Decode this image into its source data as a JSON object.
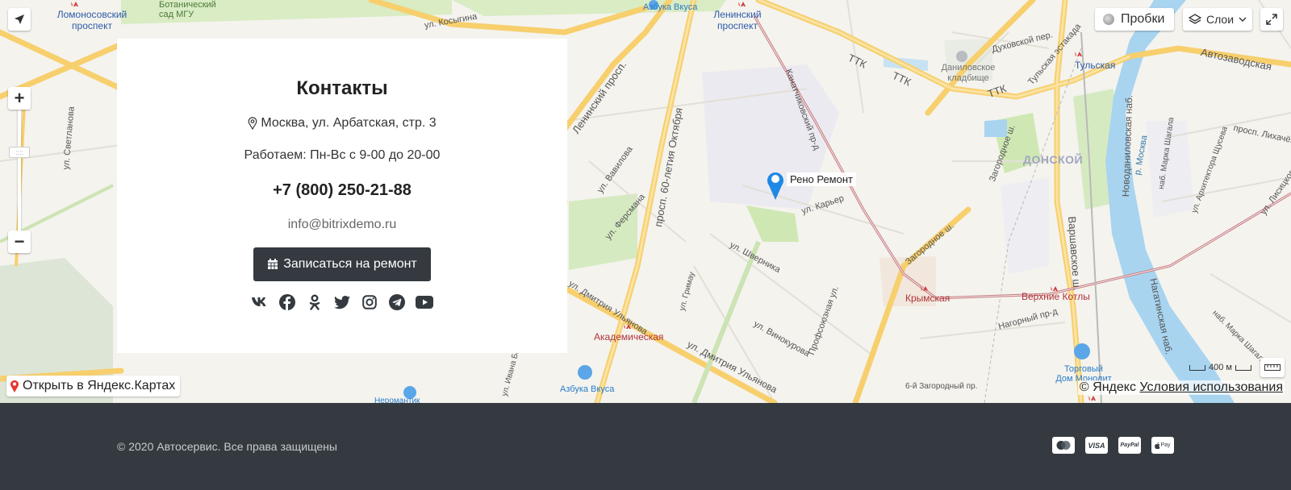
{
  "map": {
    "labels": {
      "lomonosovsky": "Ломоносовский проспект",
      "botanical": "Ботанический сад МГУ",
      "kosygina": "ул. Косыгина",
      "azbuka_top": "Азбука Вкуса",
      "leninsky_metro": "Ленинский проспект",
      "ttk1": "ТТК",
      "ttk2": "ТТК",
      "ttk3": "ТТК",
      "danilovskoe": "Даниловское кладбище",
      "dukhovsky": "Духовской пер.",
      "tulskaya_estakada": "Тульская эстакада",
      "tulskaya_metro": "Тульская",
      "avtozavodskaya": "Автозаводская",
      "leninsky_prosp": "Ленинский просп.",
      "kanatchikovsky": "Канатчиковский пр-д",
      "svetlanova": "ул. Светланова",
      "vavilova": "ул. Вавилова",
      "60_let": "просп. 60-летия Октября",
      "fersmana": "ул. Ферсмана",
      "karier": "ул. Карьер",
      "zagorodnoe1": "Загородное ш.",
      "zagorodnoe2": "Загородное ш.",
      "donskoy": "ДОНСКОЙ",
      "novodanilovskaya": "Новоданиловская наб.",
      "river": "р. Москва",
      "marka_shagala": "наб. Марка Шагала",
      "arkhitektora": "ул. Архитектора Щусева",
      "likhacheva": "просп. Лихачёва",
      "lisitskogo": "ул. Лисицкого",
      "shvernika": "ул. Шверника",
      "grimau": "ул. Гримау",
      "varshavskoe": "Варшавское ш.",
      "krymskaya": "Крымская",
      "verkhnie_kotly": "Верхние Котлы",
      "nagatinskaya": "Нагатинская наб.",
      "marka_shagala2": "наб. Марка Шагала",
      "ulyanova": "ул. Дмитрия Ульянова",
      "ulyanova2": "ул. Дмитрия Ульянова",
      "akademicheskaya": "Академическая",
      "vinokurova": "ул. Винокурова",
      "pushkinskaya": "Профсоюзная ул.",
      "nagorny": "Нагорный пр-д",
      "torgovy": "Торговый Дом Монолит",
      "zagorodny6": "6-й Загородный пр.",
      "azbuka_bottom": "Азбука Вкуса",
      "ivana_babushkina": "ул. Ивана Бабушкина",
      "neromantik": "Неромантик"
    },
    "marker_label": "Рено Ремонт",
    "controls": {
      "traffic": "Пробки",
      "layers": "Слои",
      "open_in_yandex": "Открыть в Яндекс.Картах",
      "scale": "400 м",
      "copyright": "© Яндекс",
      "terms": "Условия использования"
    }
  },
  "contacts": {
    "title": "Контакты",
    "address": "Москва, ул. Арбатская, стр. 3",
    "hours": "Работаем: Пн-Вс с 9-00 до 20-00",
    "phone": "+7 (800) 250-21-88",
    "email": "info@bitrixdemo.ru",
    "button": "Записаться на ремонт",
    "socials": [
      "vk-icon",
      "facebook-icon",
      "odnoklassniki-icon",
      "twitter-icon",
      "instagram-icon",
      "telegram-icon",
      "youtube-icon"
    ]
  },
  "footer": {
    "copyright": "© 2020 Автосервис. Все права защищены",
    "payments": [
      "mastercard-icon",
      "visa-icon",
      "paypal-icon",
      "applepay-icon"
    ],
    "visa": "VISA",
    "paypal": "PayPal",
    "applepay": "Pay"
  },
  "colors": {
    "accent": "#343a40",
    "road_major": "#f7cf6d",
    "river": "#a8d4f0",
    "park": "#cfe8b3",
    "metro": "#d13b3b",
    "marker": "#1e88e5"
  }
}
